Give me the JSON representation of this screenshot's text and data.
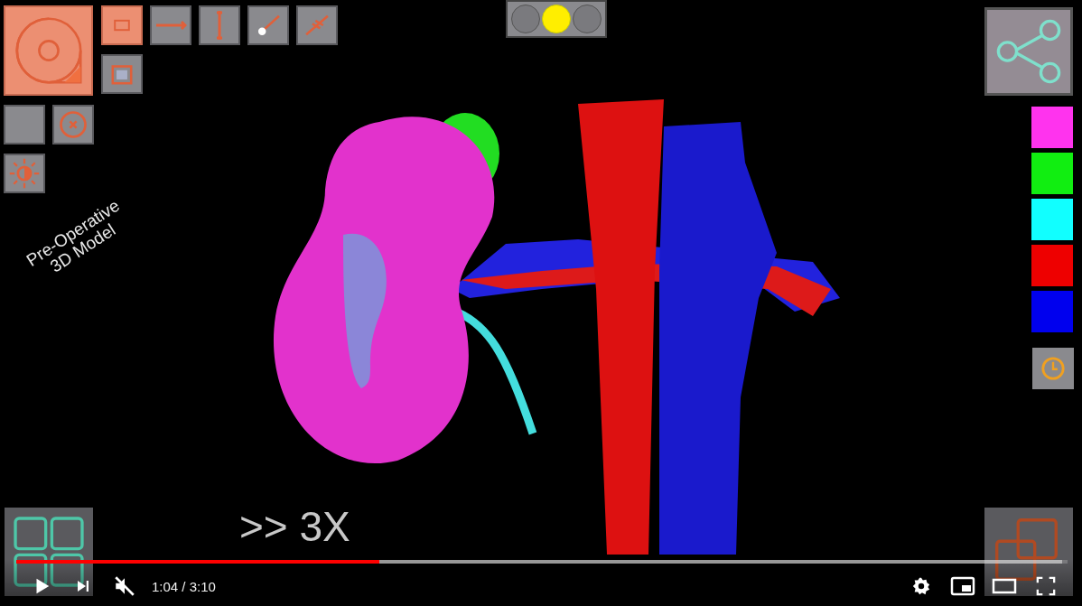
{
  "toolbar": {
    "tools": [
      {
        "kind": "disc",
        "selected": true
      },
      {
        "kind": "rect",
        "selected": true
      },
      {
        "kind": "hline",
        "selected": false
      },
      {
        "kind": "vline",
        "selected": false
      },
      {
        "kind": "probe",
        "selected": false
      },
      {
        "kind": "diagonal",
        "selected": false
      },
      {
        "kind": "frame",
        "selected": false
      },
      {
        "kind": "blank",
        "selected": false
      },
      {
        "kind": "target",
        "selected": false
      },
      {
        "kind": "brightness",
        "selected": false
      }
    ]
  },
  "caption": {
    "lines": [
      "Pre-Operative",
      "3D Model"
    ]
  },
  "speed_label": ">> 3X",
  "indicator": {
    "lights": [
      {
        "selected": false
      },
      {
        "selected": true
      },
      {
        "selected": false
      }
    ]
  },
  "swatches": [
    {
      "color": "#ff33ee"
    },
    {
      "color": "#11ee11"
    },
    {
      "color": "#11ffff"
    },
    {
      "color": "#ee0000"
    },
    {
      "color": "#0000ee"
    }
  ],
  "player": {
    "progress": {
      "level": 0.345
    },
    "buffer": {
      "level": 0.995
    },
    "time": "1:04 / 3:10",
    "muted": true
  }
}
